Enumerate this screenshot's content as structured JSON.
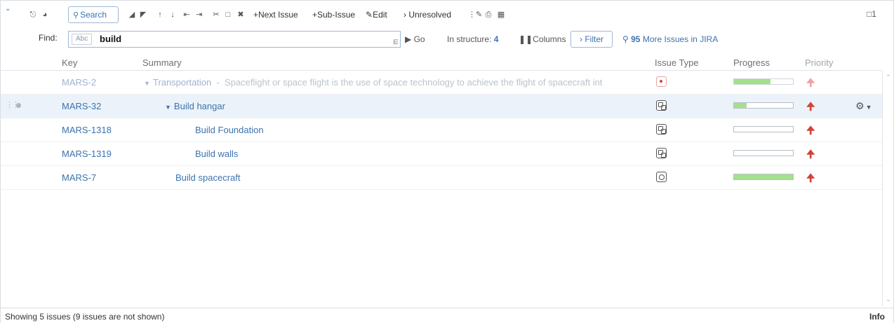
{
  "toolbar": {
    "search_label": "Search",
    "next_issue_label": "+Next Issue",
    "sub_issue_label": "+Sub-Issue",
    "edit_label": "Edit",
    "unresolved_label": "Unresolved",
    "count": "1"
  },
  "find": {
    "label": "Find:",
    "abc_chip": "Abc",
    "value": "build",
    "go_label": "Go",
    "in_structure_label": "In structure:",
    "in_structure_count": "4",
    "columns_label": "Columns",
    "filter_label": "Filter",
    "more_count": "95",
    "more_label": "More Issues in JIRA"
  },
  "columns": {
    "key": "Key",
    "summary": "Summary",
    "issue_type": "Issue Type",
    "progress": "Progress",
    "priority": "Priority"
  },
  "rows": [
    {
      "key": "MARS-2",
      "summary": "Transportation",
      "description": "Spaceflight or space flight is the use of space technology to achieve the flight of spacecraft int",
      "issue_type": "bug",
      "progress": 0.62,
      "priority": "high"
    },
    {
      "key": "MARS-32",
      "summary": "Build hangar",
      "issue_type": "sub-task",
      "progress": 0.22,
      "priority": "high"
    },
    {
      "key": "MARS-1318",
      "summary": "Build Foundation",
      "issue_type": "sub-task",
      "progress": 0,
      "priority": "high"
    },
    {
      "key": "MARS-1319",
      "summary": "Build walls",
      "issue_type": "sub-task",
      "progress": 0,
      "priority": "high"
    },
    {
      "key": "MARS-7",
      "summary": "Build spacecraft",
      "issue_type": "task",
      "progress": 1.0,
      "priority": "high"
    }
  ],
  "status": {
    "text": "Showing 5 issues (9 issues are not shown)",
    "info_label": "Info"
  },
  "colors": {
    "link": "#3b73af",
    "progress_fill": "#a5e08d",
    "priority_high": "#d04437",
    "selected_row": "#ebf2f9"
  }
}
